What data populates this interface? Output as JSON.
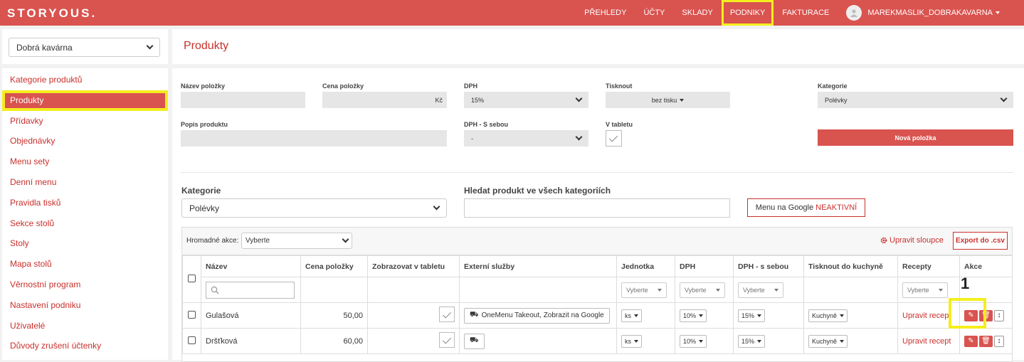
{
  "topbar": {
    "logo": "STORYOUS.",
    "nav": [
      {
        "label": "PŘEHLEDY"
      },
      {
        "label": "ÚČTY"
      },
      {
        "label": "SKLADY"
      },
      {
        "label": "PODNIKY"
      },
      {
        "label": "FAKTURACE"
      }
    ],
    "user": "MAREKMASLIK_DOBRAKAVARNA"
  },
  "venue_select": {
    "value": "Dobrá kavárna"
  },
  "sidebar": {
    "items": [
      {
        "label": "Kategorie produktů"
      },
      {
        "label": "Produkty"
      },
      {
        "label": "Přídavky"
      },
      {
        "label": "Objednávky"
      },
      {
        "label": "Menu sety"
      },
      {
        "label": "Denní menu"
      },
      {
        "label": "Pravidla tisků"
      },
      {
        "label": "Sekce stolů"
      },
      {
        "label": "Stoly"
      },
      {
        "label": "Mapa stolů"
      },
      {
        "label": "Věrnostní program"
      },
      {
        "label": "Nastavení podniku"
      },
      {
        "label": "Uživatelé"
      },
      {
        "label": "Důvody zrušení účtenky"
      }
    ]
  },
  "page_title": "Produkty",
  "form": {
    "name_label": "Název položky",
    "price_label": "Cena položky",
    "price_unit": "Kč",
    "vat_label": "DPH",
    "vat_value": "15%",
    "print_label": "Tisknout",
    "print_value": "bez tisku",
    "category_label": "Kategorie",
    "category_value": "Polévky",
    "desc_label": "Popis produktu",
    "vat_takeaway_label": "DPH - S sebou",
    "vat_takeaway_value": "-",
    "tablet_label": "V tabletu",
    "new_item_button": "Nová položka"
  },
  "filter": {
    "category_label": "Kategorie",
    "category_value": "Polévky",
    "search_label": "Hledat produkt ve všech kategoriích",
    "google_menu_label": "Menu na Google",
    "google_menu_status": "NEAKTIVNÍ"
  },
  "table": {
    "bulk_label": "Hromadné akce:",
    "bulk_value": "Vyberte",
    "edit_columns": "Upravit sloupce",
    "export": "Export do .csv",
    "headers": [
      "Název",
      "Cena položky",
      "Zobrazovat v tabletu",
      "Externí služby",
      "Jednotka",
      "DPH",
      "DPH - s sebou",
      "Tisknout do kuchyně",
      "Recepty",
      "Akce"
    ],
    "filter_placeholder": "Vyberte",
    "rows": [
      {
        "name": "Gulašová",
        "price": "50,00",
        "ext": "OneMenu Takeout, Zobrazit na Google",
        "unit": "ks",
        "vat": "10%",
        "vat_take": "15%",
        "print": "Kuchyně",
        "recipe": "Upravit recept"
      },
      {
        "name": "Dršťková",
        "price": "60,00",
        "ext": "",
        "unit": "ks",
        "vat": "10%",
        "vat_take": "15%",
        "print": "Kuchyně",
        "recipe": "Upravit recept"
      }
    ]
  },
  "annotation": {
    "marker": "1"
  }
}
